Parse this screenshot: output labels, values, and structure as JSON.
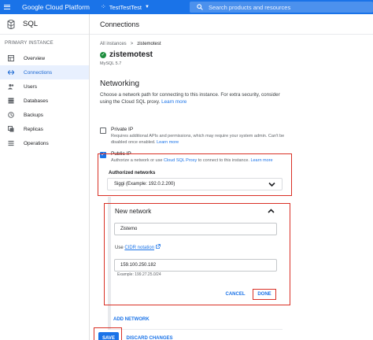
{
  "topbar": {
    "brand": "Google Cloud Platform",
    "project": "TestTestTest",
    "search_placeholder": "Search products and resources"
  },
  "sidebar": {
    "title": "SQL",
    "section": "PRIMARY INSTANCE",
    "items": [
      {
        "label": "Overview",
        "icon": "overview-icon"
      },
      {
        "label": "Connections",
        "icon": "connections-icon",
        "active": true
      },
      {
        "label": "Users",
        "icon": "users-icon"
      },
      {
        "label": "Databases",
        "icon": "databases-icon"
      },
      {
        "label": "Backups",
        "icon": "backups-icon"
      },
      {
        "label": "Replicas",
        "icon": "replicas-icon"
      },
      {
        "label": "Operations",
        "icon": "operations-icon"
      }
    ]
  },
  "main": {
    "header": "Connections",
    "breadcrumb": {
      "parent": "All instances",
      "sep": ">",
      "current": "zistemotest"
    },
    "instance_name": "zistemotest",
    "version": "MySQL 5.7",
    "networking_title": "Networking",
    "networking_desc": "Choose a network path for connecting to this instance. For extra security, consider using the Cloud SQL proxy.",
    "learn_more": "Learn more",
    "private_ip": {
      "label": "Private IP",
      "desc": "Requires additional APIs and permissions, which may require your system admin. Can't be disabled once enabled.",
      "learn_more": "Learn more",
      "checked": false
    },
    "public_ip": {
      "label": "Public IP",
      "desc_pre": "Authorize a network or use ",
      "desc_link": "Cloud SQL Proxy",
      "desc_post": " to connect to this instance.",
      "learn_more": "Learn more",
      "checked": true
    },
    "authorized_networks": {
      "label": "Authorized networks",
      "value": "Siggi (Example: 192.0.2.200)"
    },
    "new_network": {
      "title": "New network",
      "name_value": "Zistemo",
      "use_prefix": "Use",
      "cidr_link": "CIDR notation",
      "ip_value": "159.100.250.182",
      "example": "Example: 199.27.25.0/24",
      "cancel": "CANCEL",
      "done": "DONE"
    },
    "add_network": "ADD NETWORK",
    "save": "SAVE",
    "discard": "DISCARD CHANGES"
  },
  "colors": {
    "accent": "#1a73e8",
    "highlight": "#d93025",
    "success": "#1e8e3e"
  }
}
